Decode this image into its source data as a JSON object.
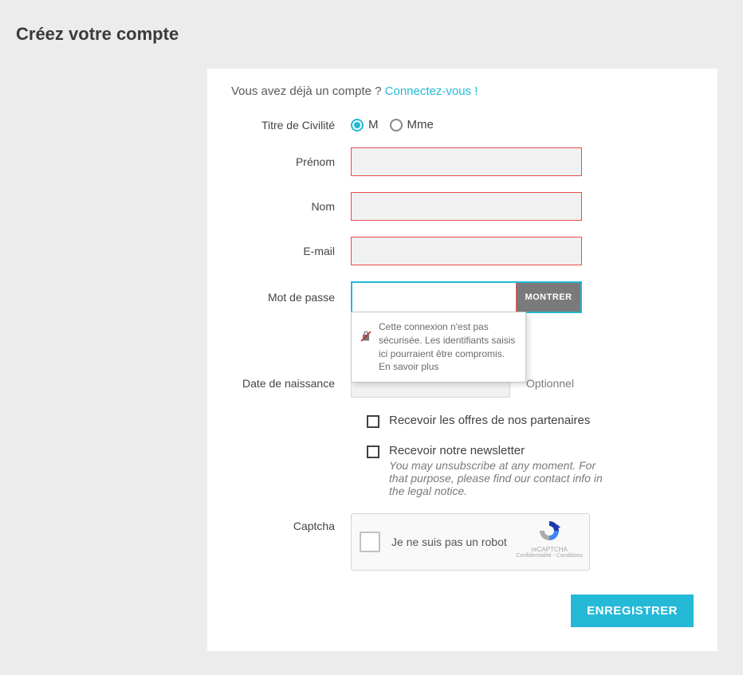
{
  "page": {
    "title": "Créez votre compte"
  },
  "login_prompt": {
    "text": "Vous avez déjà un compte ? ",
    "link": "Connectez-vous !"
  },
  "labels": {
    "civility": "Titre de Civilité",
    "firstname": "Prénom",
    "lastname": "Nom",
    "email": "E-mail",
    "password": "Mot de passe",
    "birthdate": "Date de naissance",
    "captcha": "Captcha",
    "optional": "Optionnel"
  },
  "civility_options": {
    "m": "M",
    "mme": "Mme",
    "selected": "m"
  },
  "password": {
    "show_button": "MONTRER"
  },
  "security_tooltip": {
    "text": "Cette connexion n'est pas sécurisée. Les identifiants saisis ici pourraient être compromis. ",
    "link": "En savoir plus"
  },
  "checkboxes": {
    "partners": "Recevoir les offres de nos partenaires",
    "newsletter": "Recevoir notre newsletter",
    "newsletter_sub": "You may unsubscribe at any moment. For that purpose, please find our contact info in the legal notice."
  },
  "captcha": {
    "label": "Je ne suis pas un robot",
    "brand": "reCAPTCHA",
    "links": "Confidentialité - Conditions"
  },
  "submit": {
    "label": "ENREGISTRER"
  }
}
